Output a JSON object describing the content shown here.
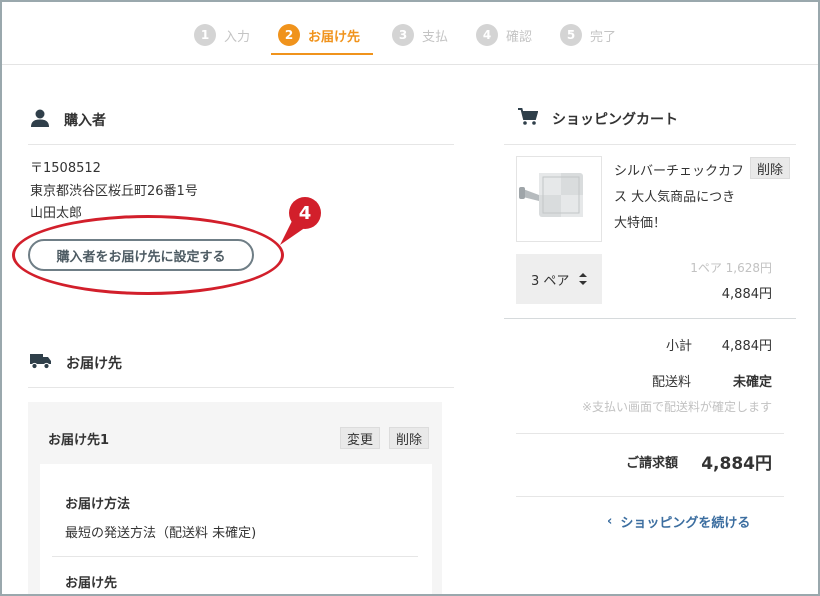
{
  "steps": [
    {
      "num": "1",
      "label": "入力"
    },
    {
      "num": "2",
      "label": "お届け先"
    },
    {
      "num": "3",
      "label": "支払"
    },
    {
      "num": "4",
      "label": "確認"
    },
    {
      "num": "5",
      "label": "完了"
    }
  ],
  "active_step": 2,
  "buyer": {
    "title": "購入者",
    "icon": "person-icon",
    "postal": "〒1508512",
    "address": "東京都渋谷区桜丘町26番1号",
    "name": "山田太郎",
    "set_button": "購入者をお届け先に設定する"
  },
  "annotation": {
    "badge": "4",
    "color": "#d21f2b"
  },
  "shipping": {
    "title": "お届け先",
    "icon": "truck-icon",
    "destination_title": "お届け先1",
    "change_button": "変更",
    "delete_button": "削除",
    "method_heading": "お届け方法",
    "method_value": "最短の発送方法（配送料 未確定)",
    "address_heading": "お届け先"
  },
  "cart": {
    "title": "ショッピングカート",
    "icon": "cart-icon",
    "item": {
      "name": "シルバーチェックカフス 大人気商品につき大特価！",
      "delete_button": "削除",
      "quantity": "3 ペア",
      "unit_price": "1ペア 1,628円",
      "line_total": "4,884円"
    },
    "subtotal_label": "小計",
    "subtotal_value": "4,884円",
    "shipping_label": "配送料",
    "shipping_value": "未確定",
    "shipping_note": "※支払い画面で配送料が確定します",
    "total_label": "ご請求額",
    "total_value": "4,884円",
    "continue_link": "ショッピングを続ける"
  },
  "colors": {
    "accent": "#f0931c",
    "link": "#3c6ea0",
    "step_inactive": "#d4d4d4"
  }
}
